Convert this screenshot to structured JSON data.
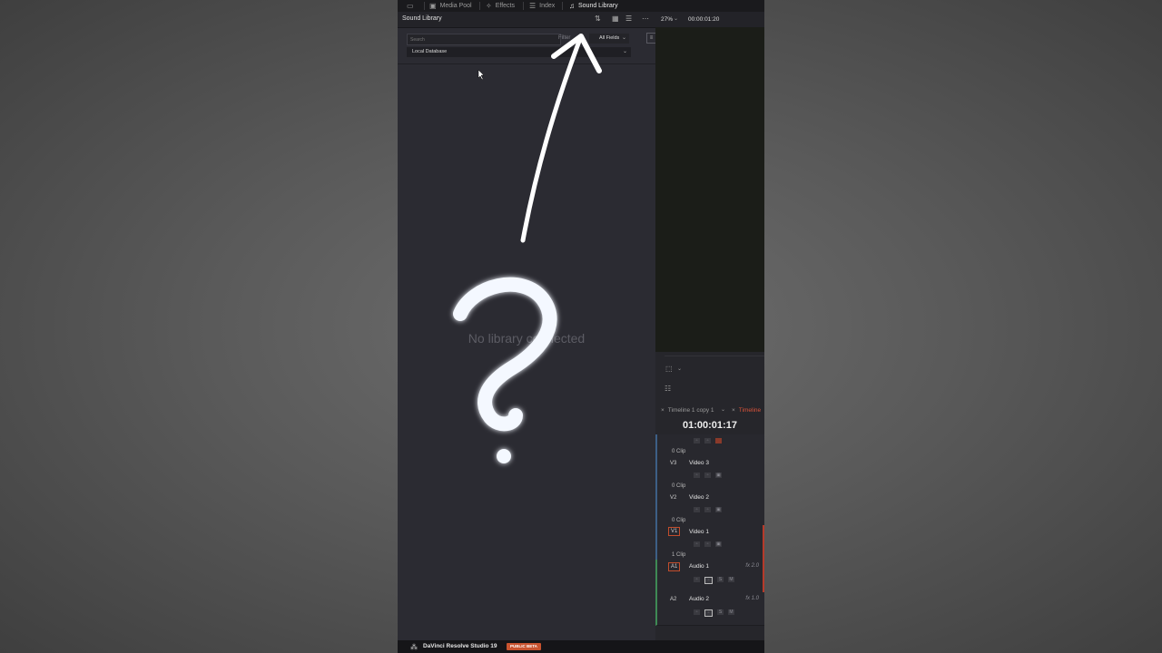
{
  "topbar": {
    "tabs": [
      {
        "label": "Media Pool",
        "icon": "media-pool-icon",
        "active": false
      },
      {
        "label": "Effects",
        "icon": "effects-wand-icon",
        "active": false
      },
      {
        "label": "Index",
        "icon": "index-list-icon",
        "active": false
      },
      {
        "label": "Sound Library",
        "icon": "sound-library-icon",
        "active": true
      }
    ]
  },
  "panel": {
    "title": "Sound Library",
    "search_placeholder": "Search",
    "filter_label": "Filter",
    "field_select": "All Fields",
    "database_select": "Local Database",
    "empty_message": "No library connected"
  },
  "viewer": {
    "zoom": "27%",
    "timecode": "00:00:01:20"
  },
  "timeline": {
    "tabs": [
      "Timeline 1 copy 1",
      "Timeline"
    ],
    "timecode": "01:00:01:17",
    "tracks": [
      {
        "id": "V3",
        "name": "Video 3",
        "clips": "0 Clip",
        "type": "video"
      },
      {
        "id": "V2",
        "name": "Video 2",
        "clips": "0 Clip",
        "type": "video"
      },
      {
        "id": "V1",
        "name": "Video 1",
        "clips": "1 Clip",
        "type": "video"
      },
      {
        "id": "A1",
        "name": "Audio 1",
        "fx": "fx 2.0",
        "type": "audio"
      },
      {
        "id": "A2",
        "name": "Audio 2",
        "fx": "fx 1.0",
        "type": "audio"
      }
    ],
    "top_clip_count": "0 Clip",
    "audio_buttons": {
      "s": "S",
      "m": "M"
    }
  },
  "statusbar": {
    "app_name": "DaVinci Resolve Studio 19",
    "badge": "PUBLIC BETA"
  },
  "colors": {
    "accent": "#c9532f",
    "video_track": "#3d5f86",
    "audio_track": "#3f8a55"
  }
}
